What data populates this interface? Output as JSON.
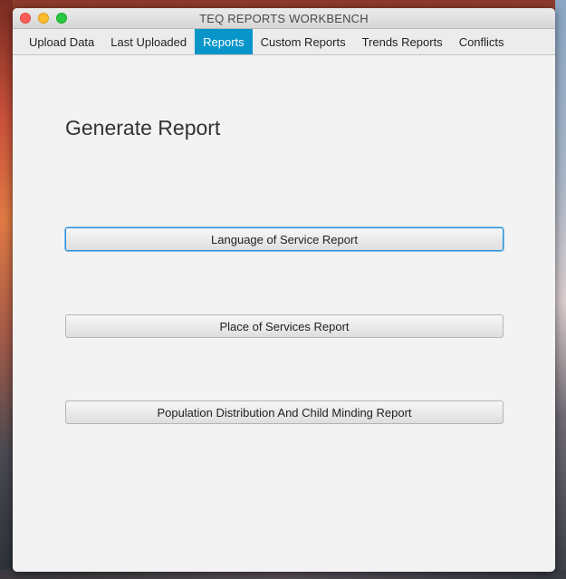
{
  "window": {
    "title": "TEQ REPORTS WORKBENCH"
  },
  "tabs": [
    {
      "label": "Upload Data",
      "active": false
    },
    {
      "label": "Last Uploaded",
      "active": false
    },
    {
      "label": "Reports",
      "active": true
    },
    {
      "label": "Custom Reports",
      "active": false
    },
    {
      "label": "Trends Reports",
      "active": false
    },
    {
      "label": "Conflicts",
      "active": false
    }
  ],
  "main": {
    "heading": "Generate Report",
    "buttons": [
      {
        "label": "Language of Service Report",
        "focused": true
      },
      {
        "label": "Place of Services Report",
        "focused": false
      },
      {
        "label": "Population Distribution And Child Minding Report",
        "focused": false
      }
    ]
  },
  "colors": {
    "active_tab": "#0895c9",
    "focus_ring": "#2a8fd6",
    "close": "#fc5f57",
    "minimize": "#fdbc2e",
    "maximize": "#28c840"
  }
}
